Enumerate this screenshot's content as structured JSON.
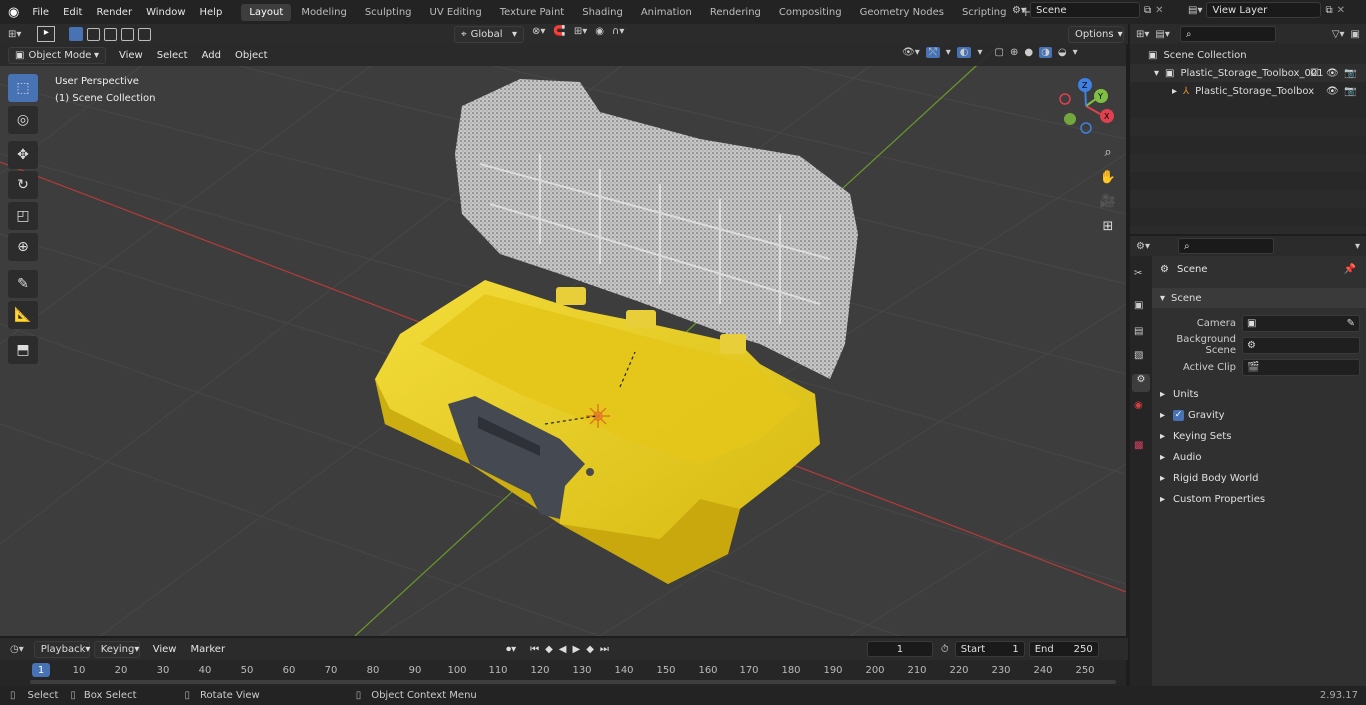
{
  "menu": [
    "File",
    "Edit",
    "Render",
    "Window",
    "Help"
  ],
  "workspaces": [
    "Layout",
    "Modeling",
    "Sculpting",
    "UV Editing",
    "Texture Paint",
    "Shading",
    "Animation",
    "Rendering",
    "Compositing",
    "Geometry Nodes",
    "Scripting"
  ],
  "active_workspace": "Layout",
  "scene_name": "Scene",
  "view_layer": "View Layer",
  "toolbar": {
    "transform": "Global",
    "options": "Options"
  },
  "viewport_header": {
    "mode": "Object Mode",
    "menus": [
      "View",
      "Select",
      "Add",
      "Object"
    ]
  },
  "viewport": {
    "view_name": "User Perspective",
    "collection": "(1) Scene Collection"
  },
  "gizmo": {
    "x": "X",
    "y": "Y",
    "z": "Z"
  },
  "outliner": {
    "root": "Scene Collection",
    "items": [
      {
        "label": "Plastic_Storage_Toolbox_001"
      },
      {
        "label": "Plastic_Storage_Toolbox"
      }
    ]
  },
  "properties": {
    "title": "Scene",
    "section": "Scene",
    "fields": [
      {
        "label": "Camera",
        "value": ""
      },
      {
        "label": "Background Scene",
        "value": ""
      },
      {
        "label": "Active Clip",
        "value": ""
      }
    ],
    "panels": [
      "Units",
      "Gravity",
      "Keying Sets",
      "Audio",
      "Rigid Body World",
      "Custom Properties"
    ]
  },
  "timeline": {
    "menus": [
      "Playback",
      "Keying",
      "View",
      "Marker"
    ],
    "current_frame": "1",
    "start_label": "Start",
    "start": "1",
    "end_label": "End",
    "end": "250",
    "ticks": [
      "1",
      "10",
      "20",
      "30",
      "40",
      "50",
      "60",
      "70",
      "80",
      "90",
      "100",
      "110",
      "120",
      "130",
      "140",
      "150",
      "160",
      "170",
      "180",
      "190",
      "200",
      "210",
      "220",
      "230",
      "240",
      "250"
    ]
  },
  "status": {
    "select": "Select",
    "box_select": "Box Select",
    "rotate": "Rotate View",
    "context": "Object Context Menu",
    "version": "2.93.17"
  },
  "colors": {
    "accent": "#4772b3",
    "toolbox_yellow": "#e8c81a",
    "grid_red": "#b83a3a",
    "grid_green": "#6a9a2a"
  }
}
